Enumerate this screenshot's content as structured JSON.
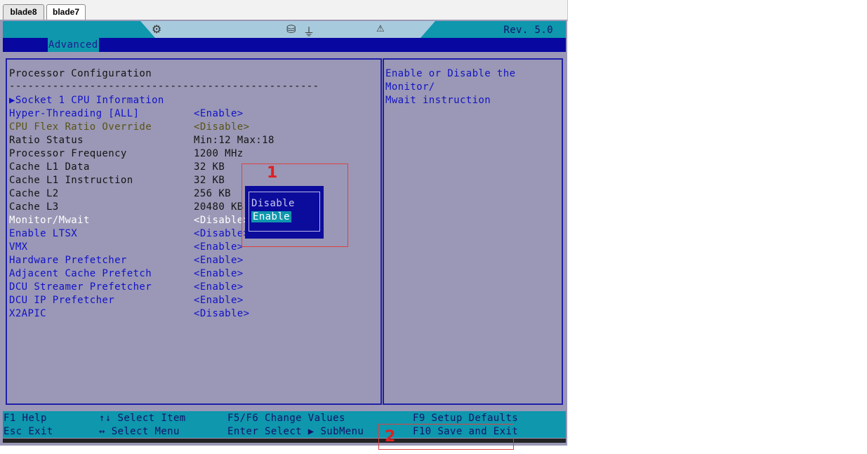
{
  "tabs": [
    {
      "label": "blade8"
    },
    {
      "label": "blade7"
    }
  ],
  "topbar": {
    "revision": "Rev. 5.0",
    "icons": [
      "cpu-chip-icon",
      "disk-icon",
      "usb-icon",
      "warning-icon"
    ]
  },
  "menu": {
    "active": "Advanced"
  },
  "main": {
    "title": "Processor Configuration",
    "separator": "--------------------------------------------------",
    "submenu": "Socket 1 CPU Information",
    "items": [
      {
        "label": "Hyper-Threading [ALL]",
        "value": "<Enable>"
      },
      {
        "label": "CPU Flex Ratio Override",
        "value": "<Disable>"
      },
      {
        "label": "Ratio Status",
        "value": "Min:12 Max:18"
      },
      {
        "label": "Processor Frequency",
        "value": "1200  MHz"
      },
      {
        "label": "Cache L1 Data",
        "value": "32 KB"
      },
      {
        "label": "Cache L1 Instruction",
        "value": "32 KB"
      },
      {
        "label": "Cache L2",
        "value": "256 KB"
      },
      {
        "label": "Cache L3",
        "value": "20480 KB"
      },
      {
        "label": "Monitor/Mwait",
        "value": "<Disable>"
      },
      {
        "label": "Enable LTSX",
        "value": "<Disable>"
      },
      {
        "label": "VMX",
        "value": "<Enable>"
      },
      {
        "label": "Hardware Prefetcher",
        "value": "<Enable>"
      },
      {
        "label": "Adjacent Cache Prefetch",
        "value": "<Enable>"
      },
      {
        "label": "DCU Streamer Prefetcher",
        "value": "<Enable>"
      },
      {
        "label": "DCU IP Prefetcher",
        "value": "<Enable>"
      },
      {
        "label": "X2APIC",
        "value": "<Disable>"
      }
    ]
  },
  "help": {
    "text": "Enable or Disable the Monitor/\nMwait instruction"
  },
  "popup": {
    "options": [
      "Disable",
      "Enable"
    ],
    "selected": "Enable"
  },
  "footer": {
    "keys": [
      {
        "key": "F1",
        "action": "Help"
      },
      {
        "key": "Esc",
        "action": "Exit"
      },
      {
        "key": "↑↓",
        "action": "Select Item"
      },
      {
        "key": "↔",
        "action": "Select Menu"
      },
      {
        "key": "F5/F6",
        "action": "Change Values"
      },
      {
        "key": "Enter",
        "action": "Select ▶ SubMenu"
      },
      {
        "key": "F9",
        "action": "Setup Defaults"
      },
      {
        "key": "F10",
        "action": "Save and Exit"
      }
    ]
  },
  "annotations": {
    "marker1": "1",
    "marker2": "2",
    "color": "#e02020"
  },
  "colors": {
    "bios_bg": "#9a98b6",
    "accent": "#0e97ad",
    "menu_bar": "#0808a0"
  }
}
